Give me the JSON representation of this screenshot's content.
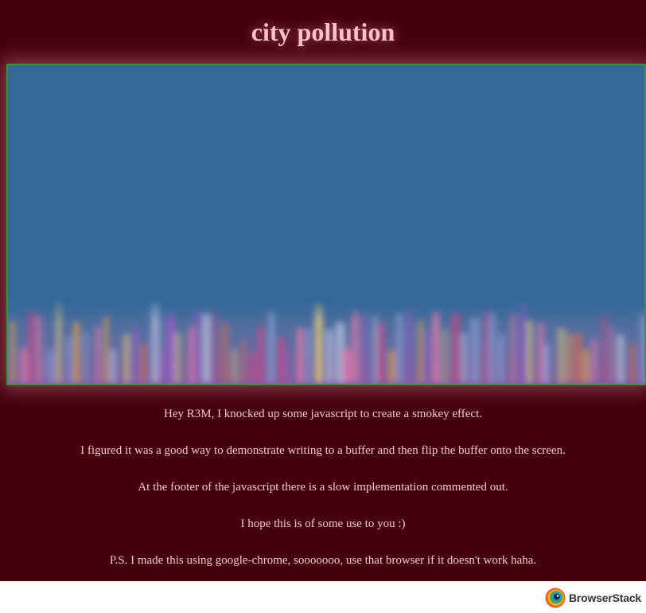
{
  "page": {
    "title": "city pollution"
  },
  "description": {
    "paragraphs": [
      "Hey R3M, I knocked up some javascript to create a smokey effect.",
      "I figured it was a good way to demonstrate writing to a buffer and then flip the buffer onto the screen.",
      "At the footer of the javascript there is a slow implementation commented out.",
      "I hope this is of some use to you :)",
      "P.S. I made this using google-chrome, sooooooo, use that browser if it doesn't work haha."
    ]
  },
  "footer": {
    "brand": "BrowserStack",
    "logo_icon": "browserstack-logo-icon"
  },
  "colors": {
    "background": "#45000f",
    "title": "#ffc0c6",
    "text": "#f2c8cf",
    "canvas_sky": "#346899",
    "canvas_border": "#3d9140"
  }
}
